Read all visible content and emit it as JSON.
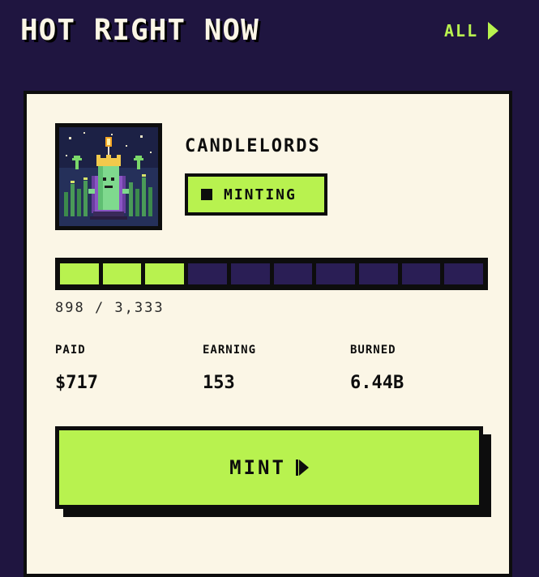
{
  "header": {
    "title": "HOT RIGHT NOW",
    "all_label": "ALL"
  },
  "card": {
    "collection_name": "CANDLELORDS",
    "status": "MINTING",
    "progress": {
      "minted": 898,
      "total": 3333,
      "label": "898 / 3,333",
      "segments_total": 10,
      "segments_filled": 3
    },
    "stats": [
      {
        "label": "PAID",
        "value": "$717"
      },
      {
        "label": "EARNING",
        "value": "153"
      },
      {
        "label": "BURNED",
        "value": "6.44B"
      }
    ],
    "mint_label": "MINT"
  },
  "colors": {
    "background": "#1f1540",
    "card": "#fbf6e6",
    "accent": "#b8f24f",
    "ink": "#0d0d0d",
    "segment_empty": "#2a1e55"
  },
  "icons": {
    "all_arrow": "play-icon",
    "mint_arrow": "play-next-icon",
    "status": "square-icon"
  }
}
